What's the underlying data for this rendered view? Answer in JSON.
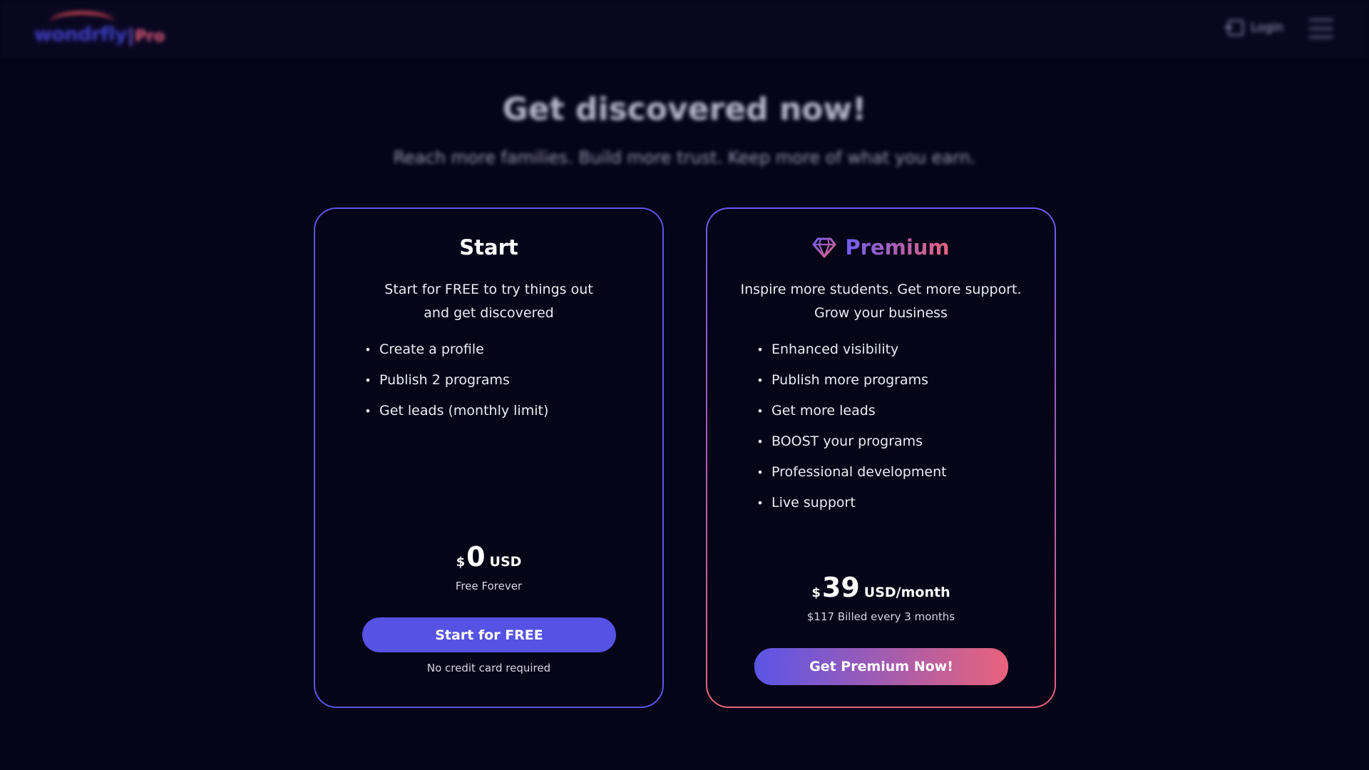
{
  "header": {
    "logo_word": "wondrfly",
    "logo_suffix": "Pro",
    "login_label": "Login"
  },
  "hero": {
    "title": "Get discovered now!",
    "subtitle": "Reach more families. Build more trust. Keep more of what you earn."
  },
  "plans": {
    "start": {
      "title": "Start",
      "description_line1": "Start for FREE to try things out",
      "description_line2": "and get discovered",
      "features": [
        "Create a profile",
        "Publish 2 programs",
        "Get leads (monthly limit)"
      ],
      "currency": "$",
      "amount": "0",
      "unit": "USD",
      "price_note": "Free Forever",
      "cta_label": "Start for FREE",
      "cta_note": "No credit card required"
    },
    "premium": {
      "title": "Premium",
      "icon": "diamond-icon",
      "description_line1": "Inspire more students. Get more support.",
      "description_line2": "Grow your business",
      "features": [
        "Enhanced visibility",
        "Publish more programs",
        "Get more leads",
        "BOOST your programs",
        "Professional development",
        "Live support"
      ],
      "currency": "$",
      "amount": "39",
      "unit": "USD/month",
      "price_note": "$117 Billed every 3 months",
      "cta_label": "Get Premium Now!"
    }
  },
  "colors": {
    "background": "#060417",
    "accent": "#5652e4",
    "premium_gradient_start": "#6a5af2",
    "premium_gradient_end": "#e8637c"
  }
}
